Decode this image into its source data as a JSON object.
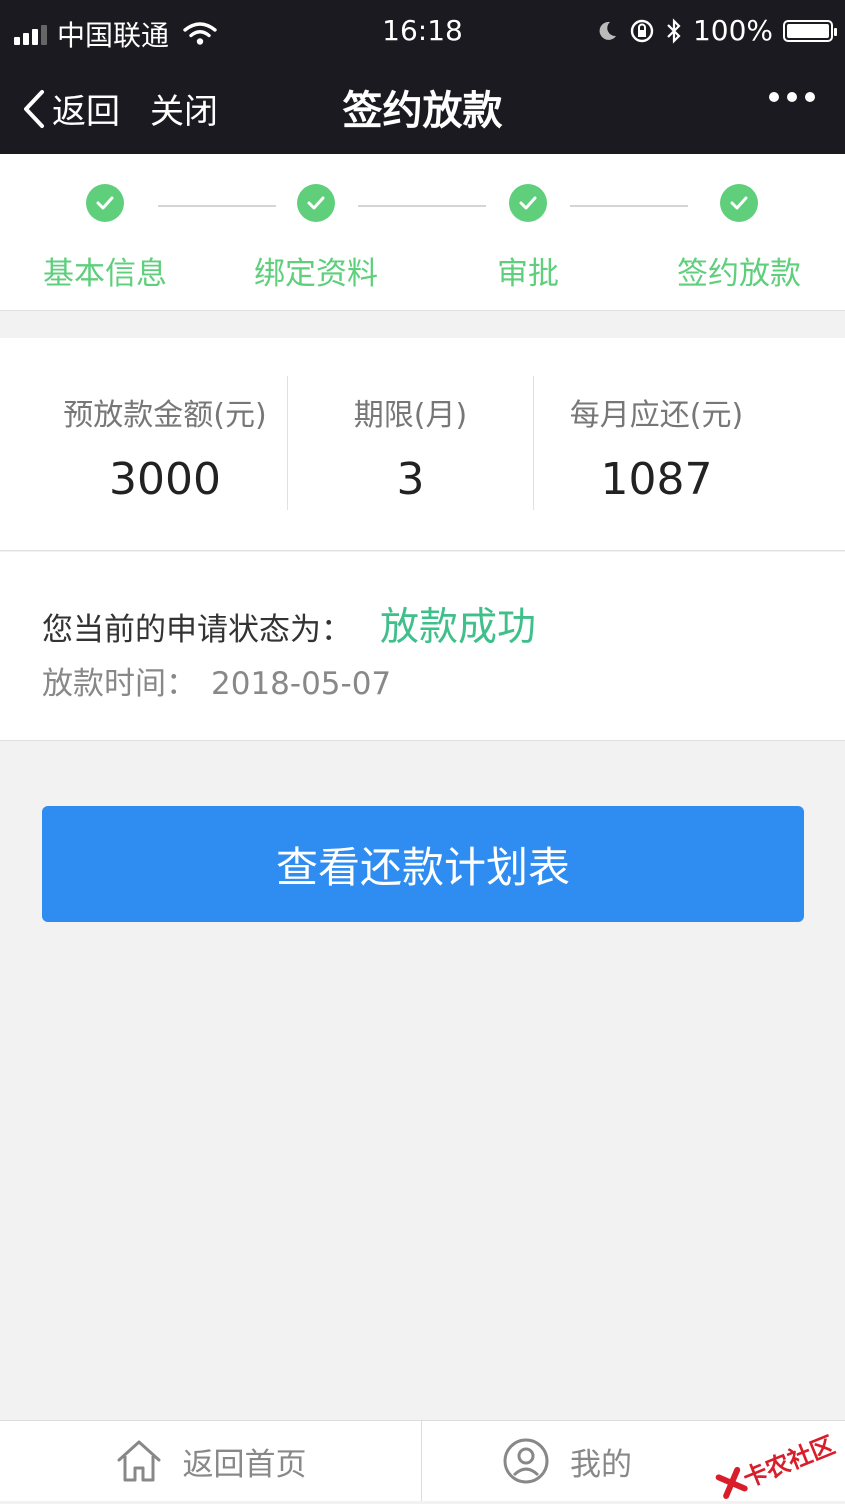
{
  "status_bar": {
    "carrier": "中国联通",
    "time": "16:18",
    "battery": "100%"
  },
  "navbar": {
    "back_label": "返回",
    "close_label": "关闭",
    "title": "签约放款"
  },
  "steps": [
    {
      "label": "基本信息"
    },
    {
      "label": "绑定资料"
    },
    {
      "label": "审批"
    },
    {
      "label": "签约放款"
    }
  ],
  "summary": [
    {
      "header": "预放款金额(元)",
      "value": "3000"
    },
    {
      "header": "期限(月)",
      "value": "3"
    },
    {
      "header": "每月应还(元)",
      "value": "1087"
    }
  ],
  "application": {
    "status_label": "您当前的申请状态为：",
    "status_value": "放款成功",
    "time_label": "放款时间：",
    "time_value": "2018-05-07"
  },
  "plan_button_label": "查看还款计划表",
  "tabbar": {
    "home_label": "返回首页",
    "mine_label": "我的"
  },
  "watermark_text": "卡农社区",
  "colors": {
    "success_green": "#5fcf7c",
    "status_green": "#3fbf8a",
    "button_blue": "#2f8cf0",
    "bar_dark": "#1b1a20"
  }
}
